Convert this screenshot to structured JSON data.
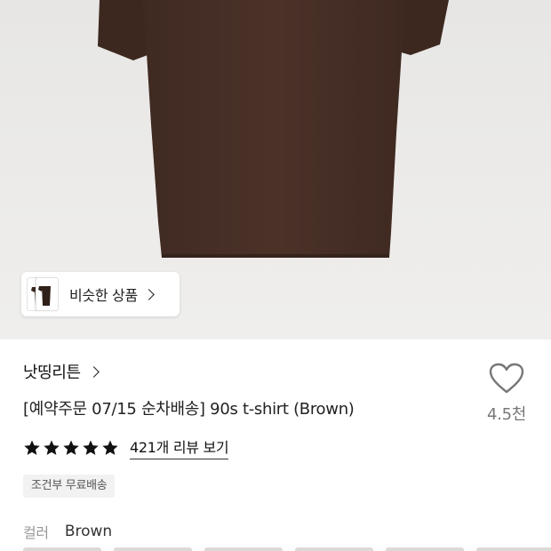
{
  "similar": {
    "label": "비슷한 상품"
  },
  "brand": {
    "name": "낫띵리튼"
  },
  "product": {
    "title": "[예약주문 07/15 순차배송] 90s t-shirt (Brown)",
    "color_hex": "#4a3128"
  },
  "wishlist": {
    "count": "4.5천",
    "icon": "heart-icon"
  },
  "rating": {
    "stars": 5,
    "max": 5,
    "review_link": "421개 리뷰 보기"
  },
  "shipping_badge": "조건부 무료배송",
  "option": {
    "label": "컬러",
    "value": "Brown"
  },
  "colors": {
    "hero_bg": "#ebeae8",
    "star": "#111111",
    "badge_bg": "#f2f2f2"
  }
}
